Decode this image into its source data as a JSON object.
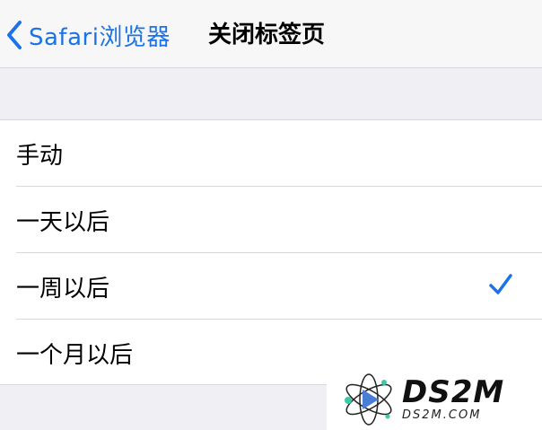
{
  "navbar": {
    "back_label": "Safari浏览器",
    "title": "关闭标签页"
  },
  "options": [
    {
      "label": "手动",
      "selected": false
    },
    {
      "label": "一天以后",
      "selected": false
    },
    {
      "label": "一周以后",
      "selected": true
    },
    {
      "label": "一个月以后",
      "selected": false
    }
  ],
  "watermark": {
    "main": "DS2M",
    "sub": "DS2M.COM"
  },
  "colors": {
    "accent": "#1a73e8",
    "background": "#efeff4",
    "navbar": "#f7f7f7",
    "cell": "#ffffff",
    "separator": "#d8d8dc"
  },
  "icons": {
    "back": "chevron-left-icon",
    "selected": "checkmark-icon"
  }
}
